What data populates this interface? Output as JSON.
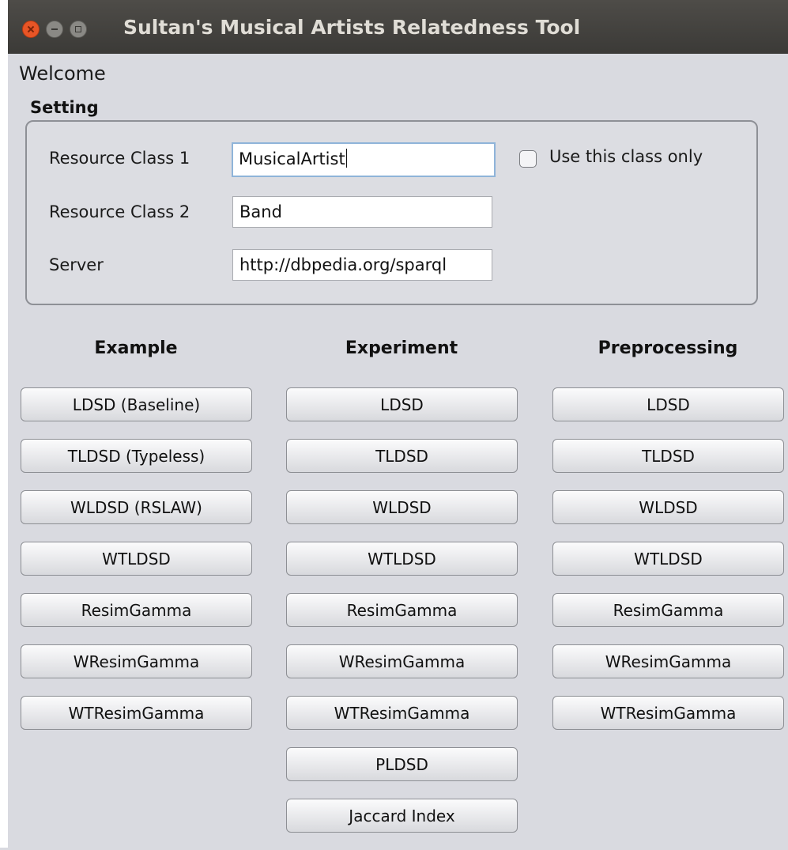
{
  "window": {
    "title": "Sultan's Musical Artists Relatedness Tool"
  },
  "welcome": "Welcome",
  "setting": {
    "title": "Setting",
    "class1": {
      "label": "Resource Class 1",
      "value": "MusicalArtist"
    },
    "class2": {
      "label": "Resource Class 2",
      "value": "Band"
    },
    "server": {
      "label": "Server",
      "value": "http://dbpedia.org/sparql"
    },
    "use_class_only": {
      "label": "Use this class only",
      "checked": false
    }
  },
  "columns": [
    {
      "heading": "Example",
      "buttons": [
        "LDSD (Baseline)",
        "TLDSD (Typeless)",
        "WLDSD (RSLAW)",
        "WTLDSD",
        "ResimGamma",
        "WResimGamma",
        "WTResimGamma"
      ]
    },
    {
      "heading": "Experiment",
      "buttons": [
        "LDSD",
        "TLDSD",
        "WLDSD",
        "WTLDSD",
        "ResimGamma",
        "WResimGamma",
        "WTResimGamma",
        "PLDSD",
        "Jaccard Index"
      ]
    },
    {
      "heading": "Preprocessing",
      "buttons": [
        "LDSD",
        "TLDSD",
        "WLDSD",
        "WTLDSD",
        "ResimGamma",
        "WResimGamma",
        "WTResimGamma"
      ]
    }
  ]
}
